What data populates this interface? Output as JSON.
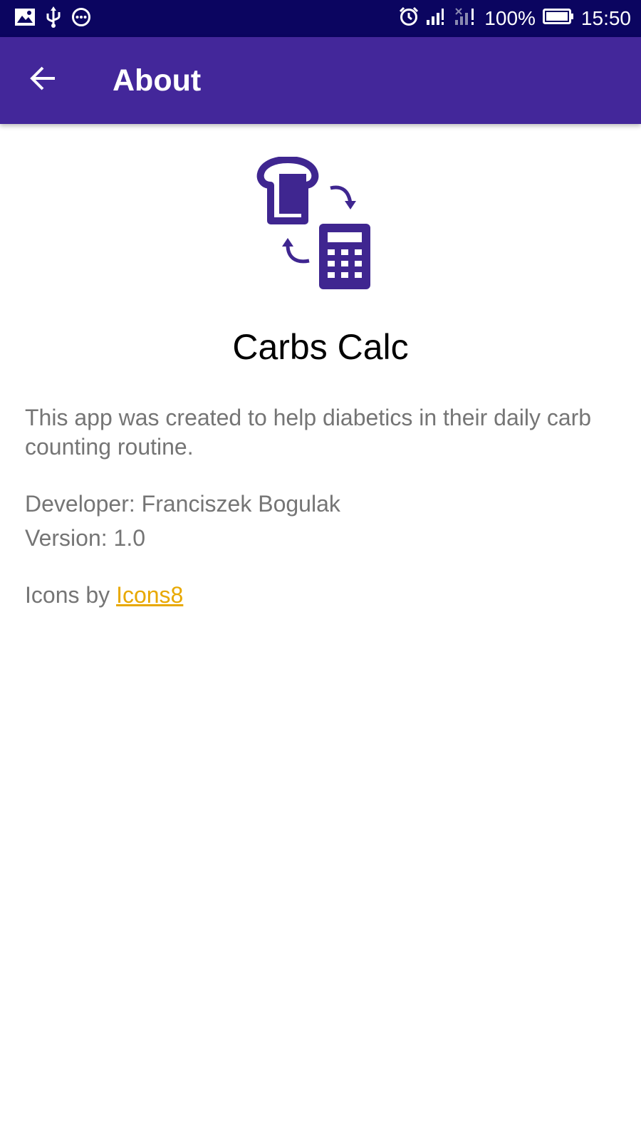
{
  "status_bar": {
    "icons": [
      "image-icon",
      "usb-icon",
      "more-circle-icon",
      "alarm-icon",
      "signal-icon",
      "signal-no-data-icon",
      "battery-icon"
    ],
    "battery": "100%",
    "time": "15:50"
  },
  "app_bar": {
    "back_icon": "arrow-back-icon",
    "title": "About"
  },
  "colors": {
    "status_bar": "#0b0560",
    "app_bar": "#43279a",
    "logo": "#3f2690",
    "link": "#e8a800",
    "body_text": "#757575"
  },
  "about": {
    "logo_icon": "bread-calculator-icon",
    "app_name": "Carbs Calc",
    "description": "This app was created to help diabetics in their daily carb counting routine.",
    "developer": "Developer: Franciszek Bogulak",
    "version": "Version: 1.0",
    "icons_credit_prefix": "Icons by ",
    "icons_credit_link": "Icons8"
  }
}
